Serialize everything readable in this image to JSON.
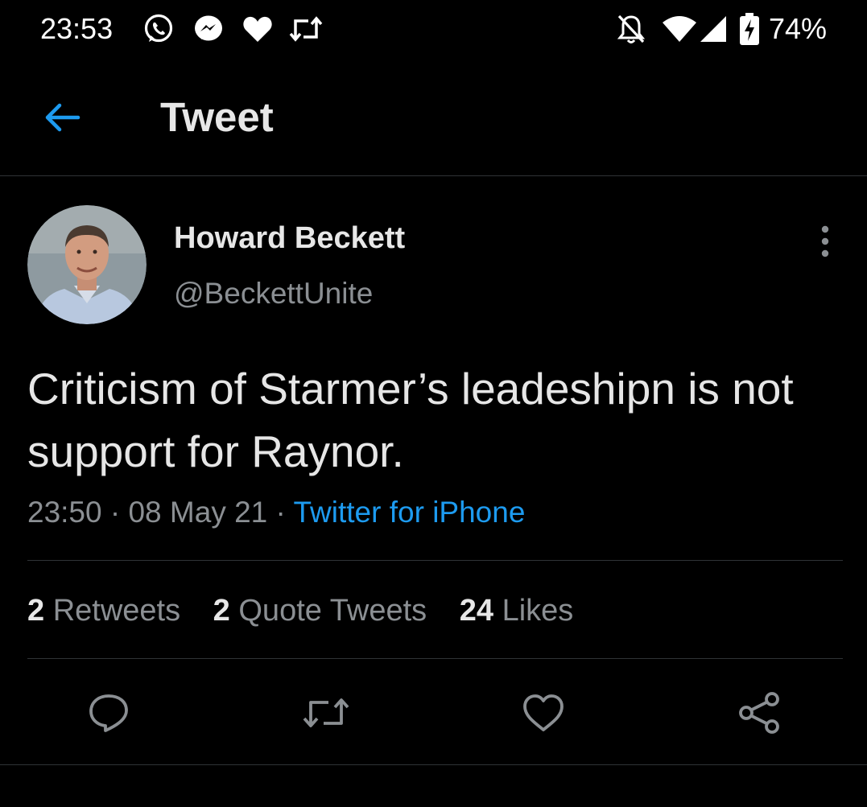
{
  "status_bar": {
    "time": "23:53",
    "notification_icons": [
      "whatsapp-icon",
      "messenger-icon",
      "heart-icon",
      "retweet-icon"
    ],
    "system_icons": [
      "notifications-off-icon",
      "wifi-icon",
      "cell-signal-icon",
      "battery-charging-icon"
    ],
    "battery_percent": "74%"
  },
  "header": {
    "back_icon": "arrow-left-icon",
    "title": "Tweet",
    "accent_color": "#1d9bf0"
  },
  "tweet": {
    "author_name": "Howard Beckett",
    "author_handle": "@BeckettUnite",
    "text": "Criticism of Starmer’s leadeshipn is not support for Raynor.",
    "time": "23:50",
    "separator": "·",
    "date": "08 May 21",
    "source": "Twitter for iPhone",
    "stats": {
      "retweets_count": "2",
      "retweets_label": "Retweets",
      "quotes_count": "2",
      "quotes_label": "Quote Tweets",
      "likes_count": "24",
      "likes_label": "Likes"
    },
    "actions": [
      "reply-icon",
      "retweet-icon",
      "like-icon",
      "share-icon"
    ]
  }
}
